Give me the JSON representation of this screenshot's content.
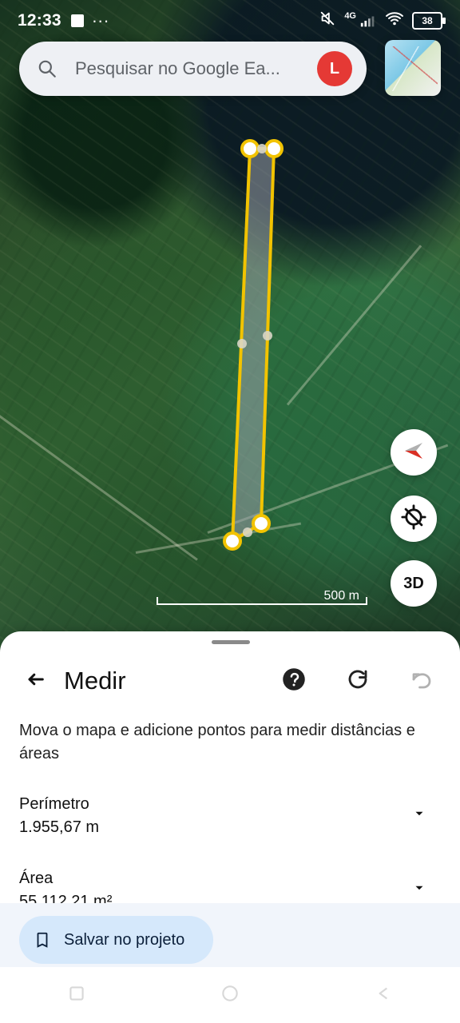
{
  "status_bar": {
    "time": "12:33",
    "more": "···",
    "network_label": "4G",
    "battery_level": "38"
  },
  "search": {
    "placeholder": "Pesquisar no Google Ea...",
    "avatar_initial": "L"
  },
  "map": {
    "scale_label": "500 m",
    "three_d_label": "3D"
  },
  "sheet": {
    "title": "Medir",
    "instruction": "Mova o mapa e adicione pontos para medir distâncias e áreas",
    "perimeter_label": "Perímetro",
    "perimeter_value": "1.955,67 m",
    "area_label": "Área",
    "area_value": "55.112,21 m²",
    "save_button_label": "Salvar no projeto"
  },
  "colors": {
    "measure_line": "#f2c300",
    "measure_fill": "#9aa0aa",
    "sheet_bg": "#ffffff",
    "save_btn_bg": "#d5e8fb",
    "avatar_bg": "#e53935"
  }
}
